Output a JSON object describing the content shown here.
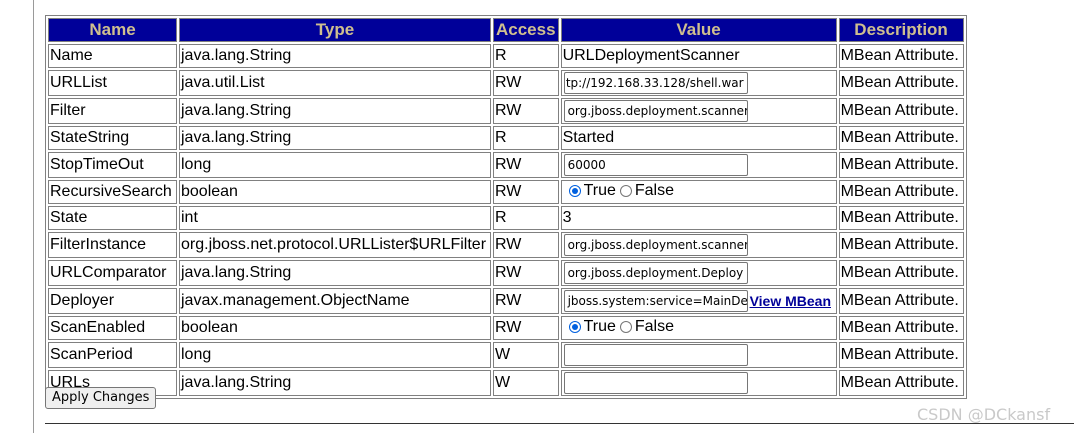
{
  "table": {
    "headers": [
      "Name",
      "Type",
      "Access",
      "Value",
      "Description"
    ],
    "rows": [
      {
        "name": "Name",
        "type": "java.lang.String",
        "access": "R",
        "value_kind": "text",
        "value": "URLDeploymentScanner",
        "description": "MBean Attribute."
      },
      {
        "name": "URLList",
        "type": "java.util.List",
        "access": "RW",
        "value_kind": "input",
        "value": "tp://192.168.33.128/shell.war]",
        "description": "MBean Attribute."
      },
      {
        "name": "Filter",
        "type": "java.lang.String",
        "access": "RW",
        "value_kind": "input",
        "value": "org.jboss.deployment.scanner",
        "description": "MBean Attribute."
      },
      {
        "name": "StateString",
        "type": "java.lang.String",
        "access": "R",
        "value_kind": "text",
        "value": "Started",
        "description": "MBean Attribute."
      },
      {
        "name": "StopTimeOut",
        "type": "long",
        "access": "RW",
        "value_kind": "input",
        "value": "60000",
        "description": "MBean Attribute."
      },
      {
        "name": "RecursiveSearch",
        "type": "boolean",
        "access": "RW",
        "value_kind": "radio",
        "true_label": "True",
        "false_label": "False",
        "selected": "True",
        "description": "MBean Attribute."
      },
      {
        "name": "State",
        "type": "int",
        "access": "R",
        "value_kind": "text",
        "value": "3",
        "description": "MBean Attribute."
      },
      {
        "name": "FilterInstance",
        "type": "org.jboss.net.protocol.URLLister$URLFilter",
        "access": "RW",
        "value_kind": "input",
        "value": "org.jboss.deployment.scanner",
        "description": "MBean Attribute."
      },
      {
        "name": "URLComparator",
        "type": "java.lang.String",
        "access": "RW",
        "value_kind": "input",
        "value": "org.jboss.deployment.Deploy",
        "description": "MBean Attribute."
      },
      {
        "name": "Deployer",
        "type": "javax.management.ObjectName",
        "access": "RW",
        "value_kind": "input_link",
        "value": "jboss.system:service=MainDe",
        "link_label": "View MBean",
        "description": "MBean Attribute."
      },
      {
        "name": "ScanEnabled",
        "type": "boolean",
        "access": "RW",
        "value_kind": "radio",
        "true_label": "True",
        "false_label": "False",
        "selected": "True",
        "description": "MBean Attribute."
      },
      {
        "name": "ScanPeriod",
        "type": "long",
        "access": "W",
        "value_kind": "input",
        "value": "",
        "description": "MBean Attribute."
      },
      {
        "name": "URLs",
        "type": "java.lang.String",
        "access": "W",
        "value_kind": "input",
        "value": "",
        "description": "MBean Attribute."
      }
    ]
  },
  "apply_button_label": "Apply Changes",
  "watermark": "CSDN @DCkansf",
  "colors": {
    "header_bg": "#000099",
    "header_text": "#cfbf8f",
    "link": "#000099",
    "radio_accent": "#0060df"
  }
}
